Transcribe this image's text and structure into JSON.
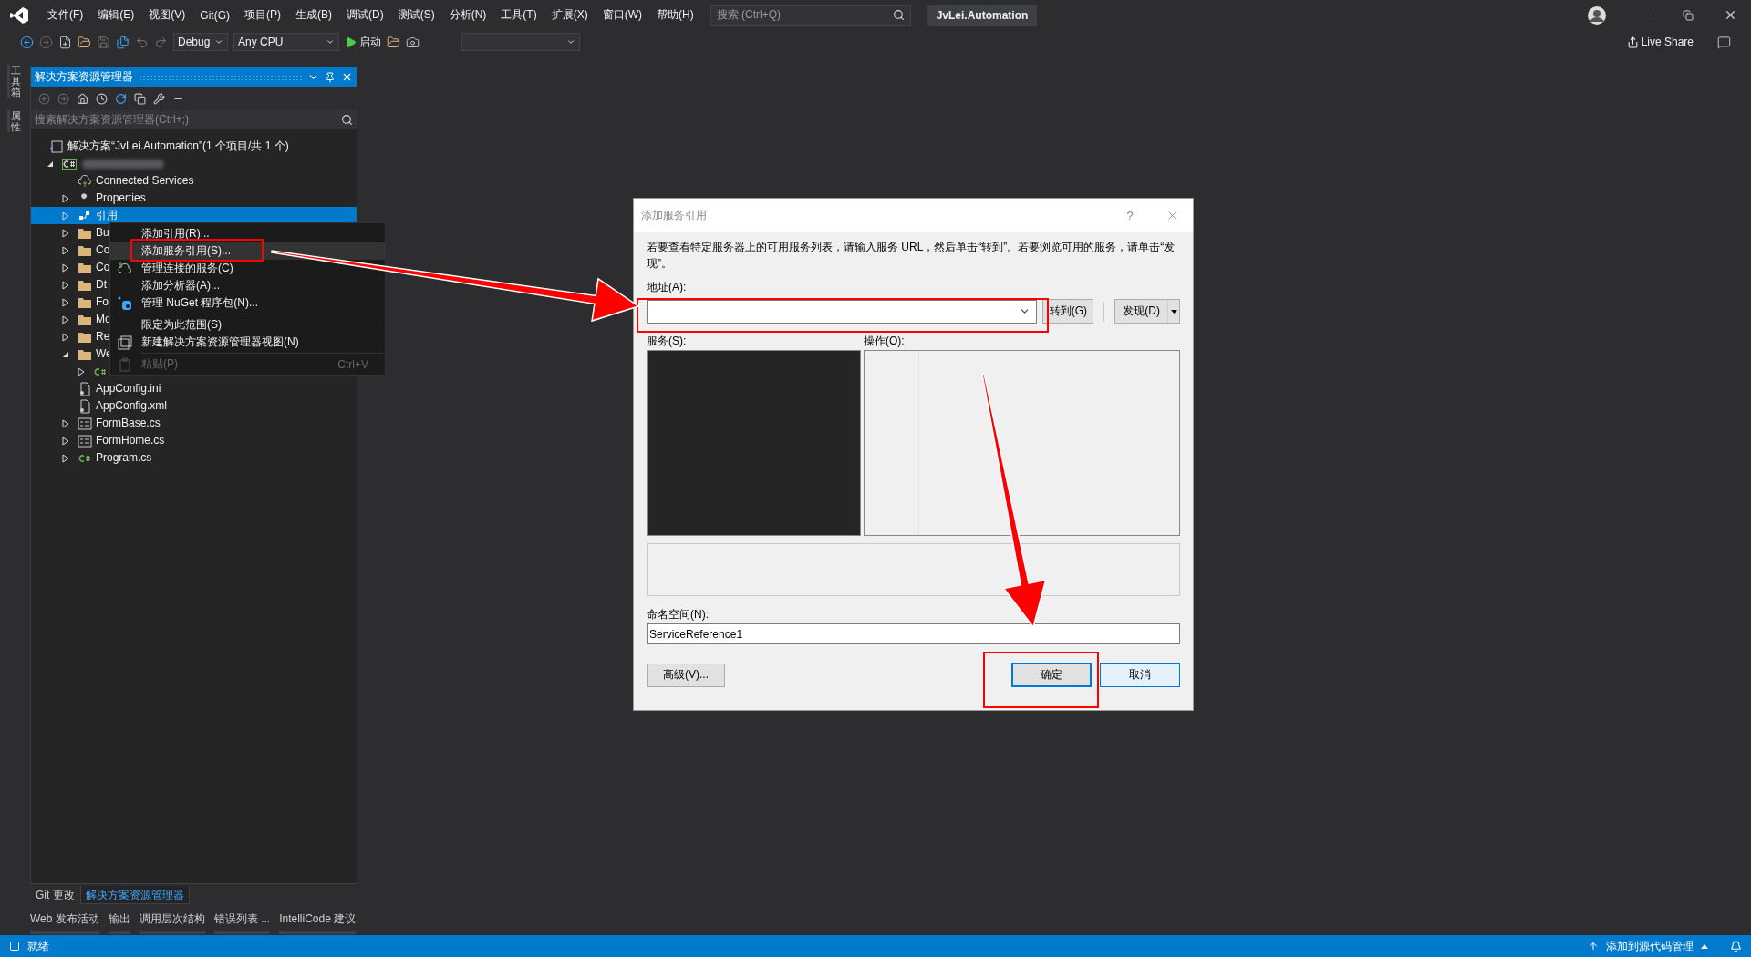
{
  "menu_bar": {
    "items": [
      "文件(F)",
      "编辑(E)",
      "视图(V)",
      "Git(G)",
      "项目(P)",
      "生成(B)",
      "调试(D)",
      "测试(S)",
      "分析(N)",
      "工具(T)",
      "扩展(X)",
      "窗口(W)",
      "帮助(H)"
    ],
    "search": {
      "placeholder": "搜索 (Ctrl+Q)"
    },
    "solution_name": "JvLei.Automation"
  },
  "toolbar": {
    "configuration": "Debug",
    "platform": "Any CPU",
    "start": "启动",
    "live_share": "Live Share"
  },
  "side_strip": [
    "工具箱",
    "属性"
  ],
  "solution_explorer": {
    "title": "解决方案资源管理器",
    "search": {
      "placeholder": "搜索解决方案资源管理器(Ctrl+;)"
    },
    "tree": [
      {
        "label": "解决方案“JvLei.Automation”(1 个项目/共 1 个)",
        "kind": "solution",
        "selected": false,
        "children": [
          {
            "kind": "project",
            "expanded": true,
            "selected": false,
            "children": [
              {
                "label": "Connected Services",
                "kind": "connected",
                "selected": false
              },
              {
                "label": "Properties",
                "kind": "properties",
                "expanded": false,
                "selected": false
              },
              {
                "label": "引用",
                "kind": "references",
                "expanded": false,
                "selected": true
              },
              {
                "label": "Bu",
                "kind": "folder",
                "expanded": false,
                "selected": false
              },
              {
                "label": "Co",
                "kind": "folder",
                "expanded": false,
                "selected": false
              },
              {
                "label": "Co",
                "kind": "folder",
                "expanded": false,
                "selected": false
              },
              {
                "label": "Dt",
                "kind": "folder",
                "expanded": false,
                "selected": false
              },
              {
                "label": "Fo",
                "kind": "folder",
                "expanded": false,
                "selected": false
              },
              {
                "label": "Mo",
                "kind": "folder",
                "expanded": false,
                "selected": false
              },
              {
                "label": "Re",
                "kind": "folder",
                "expanded": false,
                "selected": false
              },
              {
                "label": "We",
                "kind": "folder",
                "expanded": true,
                "selected": false,
                "children": [
                  {
                    "kind": "code",
                    "expanded": false,
                    "selected": false
                  }
                ]
              },
              {
                "label": "AppConfig.ini",
                "kind": "config",
                "selected": false
              },
              {
                "label": "AppConfig.xml",
                "kind": "config",
                "selected": false
              },
              {
                "label": "FormBase.cs",
                "kind": "form",
                "expanded": false,
                "selected": false
              },
              {
                "label": "FormHome.cs",
                "kind": "form",
                "expanded": false,
                "selected": false
              },
              {
                "label": "Program.cs",
                "kind": "code",
                "expanded": false,
                "selected": false
              }
            ]
          }
        ]
      }
    ]
  },
  "context_menu": {
    "items": [
      {
        "kind": "plain",
        "label": "添加引用(R)...",
        "selected": false,
        "disabled": false
      },
      {
        "kind": "plain",
        "label": "添加服务引用(S)...",
        "selected": true,
        "disabled": false
      },
      {
        "kind": "connected",
        "label": "管理连接的服务(C)",
        "selected": false,
        "disabled": false
      },
      {
        "kind": "plain",
        "label": "添加分析器(A)...",
        "selected": false,
        "disabled": false
      },
      {
        "kind": "nuget",
        "label": "管理 NuGet 程序包(N)...",
        "selected": false,
        "disabled": false
      },
      {
        "kind": "separator"
      },
      {
        "kind": "plain",
        "label": "限定为此范围(S)",
        "selected": false,
        "disabled": false
      },
      {
        "kind": "new-view",
        "label": "新建解决方案资源管理器视图(N)",
        "selected": false,
        "disabled": false
      },
      {
        "kind": "separator"
      },
      {
        "kind": "paste",
        "label": "粘贴(P)",
        "shortcut": "Ctrl+V",
        "selected": false,
        "disabled": true
      }
    ]
  },
  "dialog": {
    "title": "添加服务引用",
    "help": "?",
    "description": "若要查看特定服务器上的可用服务列表，请输入服务 URL，然后单击“转到”。若要浏览可用的服务，请单击“发现”。",
    "address": {
      "label": "地址(A):"
    },
    "go_button": "转到(G)",
    "discover_button": "发现(D)",
    "services_label": "服务(S):",
    "operations_label": "操作(O):",
    "namespace": {
      "label": "命名空间(N):",
      "value": "ServiceReference1"
    },
    "buttons": [
      {
        "label": "高级(V)...",
        "default": false,
        "hovered": false
      },
      {
        "label": "确定",
        "default": true,
        "hovered": false
      },
      {
        "label": "取消",
        "default": false,
        "hovered": true
      }
    ]
  },
  "bottom_tabs": [
    {
      "label": "Git 更改",
      "selected": false
    },
    {
      "label": "解决方案资源管理器",
      "selected": true
    }
  ],
  "tool_tabs": [
    "Web 发布活动",
    "输出",
    "调用层次结构",
    "错误列表 ...",
    "IntelliCode 建议"
  ],
  "status_bar": {
    "text": "就绪",
    "source_control": "添加到源代码管理"
  }
}
